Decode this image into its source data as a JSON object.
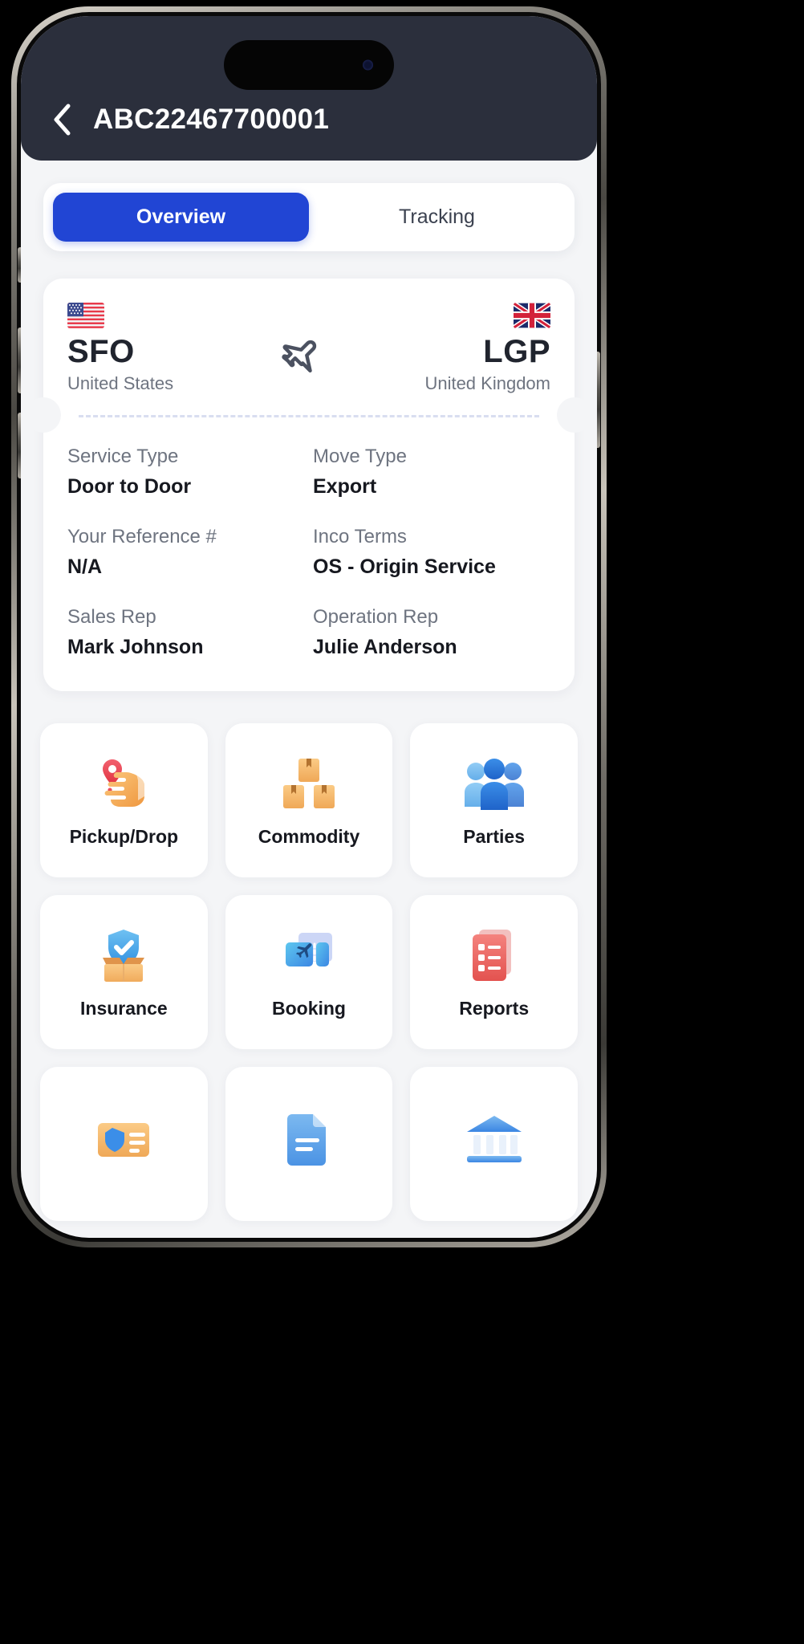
{
  "header": {
    "title": "ABC22467700001",
    "back_icon": "chevron-left-icon"
  },
  "tabs": [
    {
      "label": "Overview",
      "active": true
    },
    {
      "label": "Tracking",
      "active": false
    }
  ],
  "route": {
    "origin": {
      "code": "SFO",
      "country": "United States",
      "flag": "us-flag-icon"
    },
    "destination": {
      "code": "LGP",
      "country": "United Kingdom",
      "flag": "uk-flag-icon"
    },
    "mode_icon": "airplane-icon"
  },
  "details": [
    {
      "label": "Service Type",
      "value": "Door to Door"
    },
    {
      "label": "Move Type",
      "value": "Export"
    },
    {
      "label": "Your Reference #",
      "value": "N/A"
    },
    {
      "label": "Inco Terms",
      "value": "OS - Origin Service"
    },
    {
      "label": "Sales Rep",
      "value": "Mark Johnson"
    },
    {
      "label": "Operation Rep",
      "value": "Julie Anderson"
    }
  ],
  "tiles": [
    {
      "label": "Pickup/Drop",
      "icon": "hand-location-package-icon"
    },
    {
      "label": "Commodity",
      "icon": "boxes-stack-icon"
    },
    {
      "label": "Parties",
      "icon": "people-group-icon"
    },
    {
      "label": "Insurance",
      "icon": "shield-box-icon"
    },
    {
      "label": "Booking",
      "icon": "flight-ticket-icon"
    },
    {
      "label": "Reports",
      "icon": "report-checklist-icon"
    },
    {
      "label": "",
      "icon": "id-card-icon"
    },
    {
      "label": "",
      "icon": "document-icon"
    },
    {
      "label": "",
      "icon": "bank-icon"
    }
  ],
  "colors": {
    "accent": "#2145d4",
    "header_bg": "#2b2f3c",
    "page_bg": "#f4f5f7",
    "card_bg": "#ffffff",
    "label_text": "#6e7480",
    "value_text": "#16181f"
  }
}
